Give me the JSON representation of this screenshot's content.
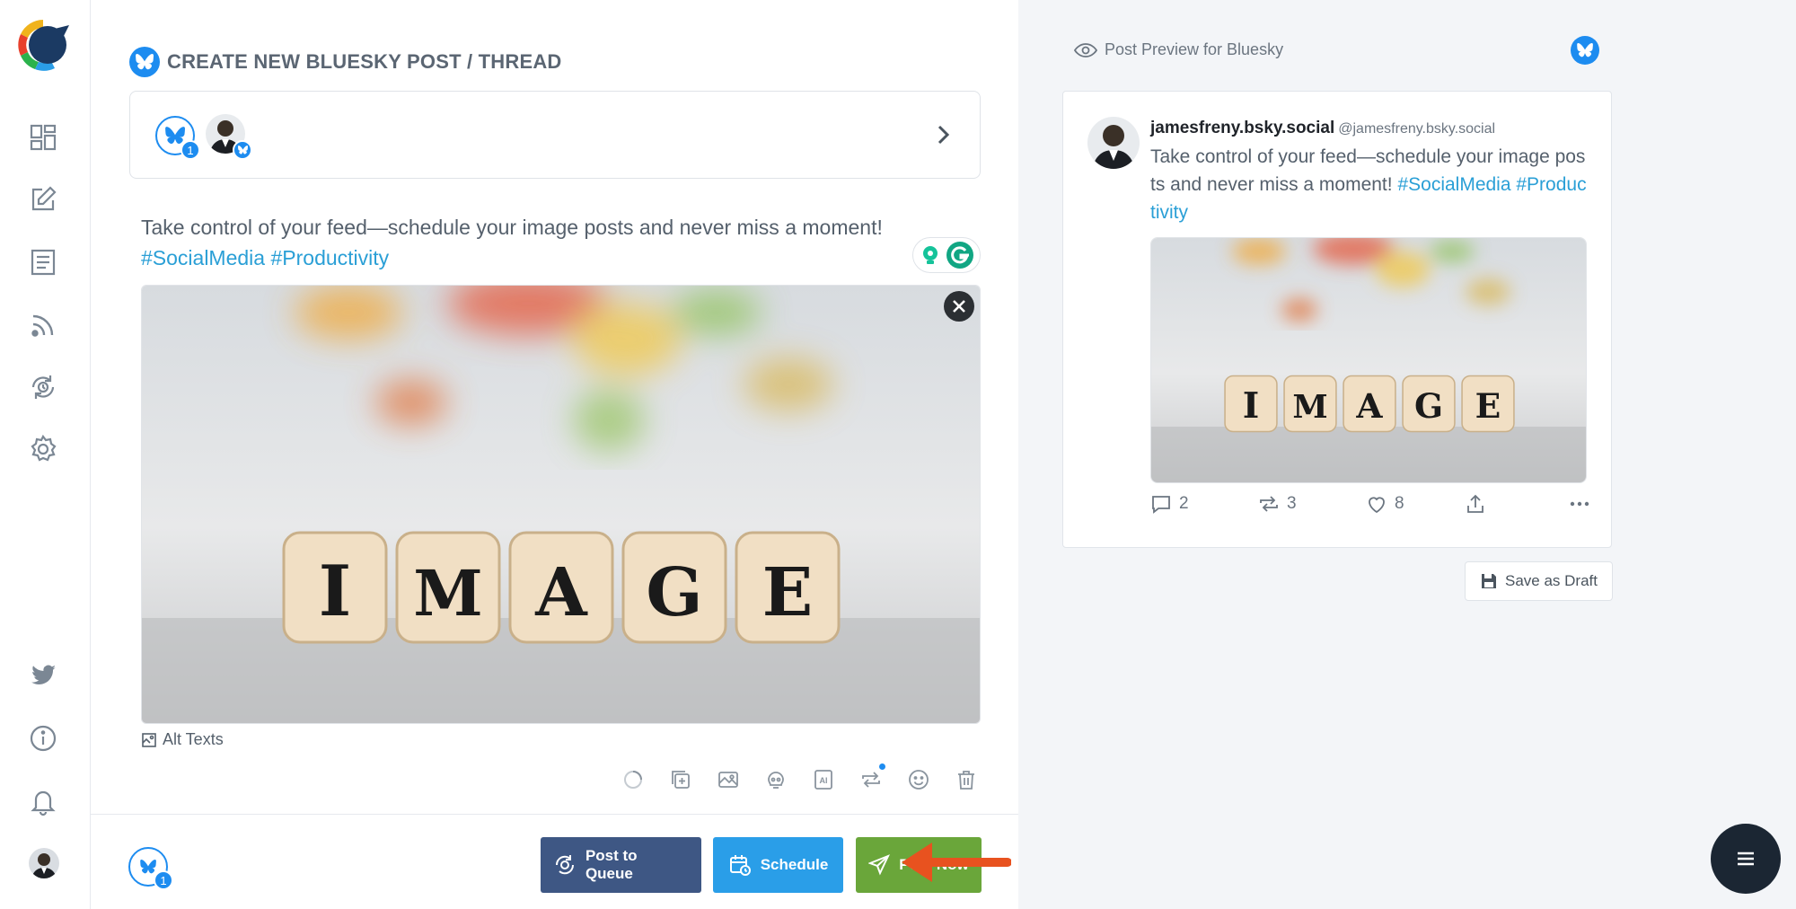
{
  "app": {
    "page_title": "CREATE NEW BLUESKY POST / THREAD"
  },
  "sidebar": {
    "items": [
      {
        "icon": "dashboard-icon"
      },
      {
        "icon": "compose-icon"
      },
      {
        "icon": "posts-list-icon"
      },
      {
        "icon": "rss-feed-icon"
      },
      {
        "icon": "recycle-queue-icon"
      },
      {
        "icon": "settings-gear-icon"
      },
      {
        "icon": "twitter-bird-icon"
      },
      {
        "icon": "info-icon"
      },
      {
        "icon": "notification-bell-icon"
      }
    ]
  },
  "composer": {
    "account_count": "1",
    "text_plain": "Take control of your feed—schedule your image posts and never miss a moment!",
    "hashtag_1": "#SocialMedia",
    "hashtag_2": "#Productivity",
    "image_word": "IMAGE",
    "alt_texts_label": "Alt Texts",
    "bottom_account_count": "1"
  },
  "actions": {
    "queue_label": "Post to Queue",
    "schedule_label": "Schedule",
    "now_label": "Post Now"
  },
  "preview": {
    "heading": "Post Preview for Bluesky",
    "display_name": "jamesfreny.bsky.social",
    "handle": "@jamesfreny.bsky.social",
    "text_plain": "Take control of your feed—schedule your image posts and never miss a moment!",
    "hashtag_1": "#SocialMedia",
    "hashtag_2": "#Productivity",
    "replies": "2",
    "reposts": "3",
    "likes": "8",
    "save_draft_label": "Save as Draft"
  },
  "colors": {
    "bluesky": "#1d8cf0",
    "queue_button": "#3e5784",
    "schedule_button": "#2a9ee8",
    "post_now_button": "#6aa63a",
    "hashtag": "#2a9fd6",
    "arrow": "#e8521f"
  }
}
